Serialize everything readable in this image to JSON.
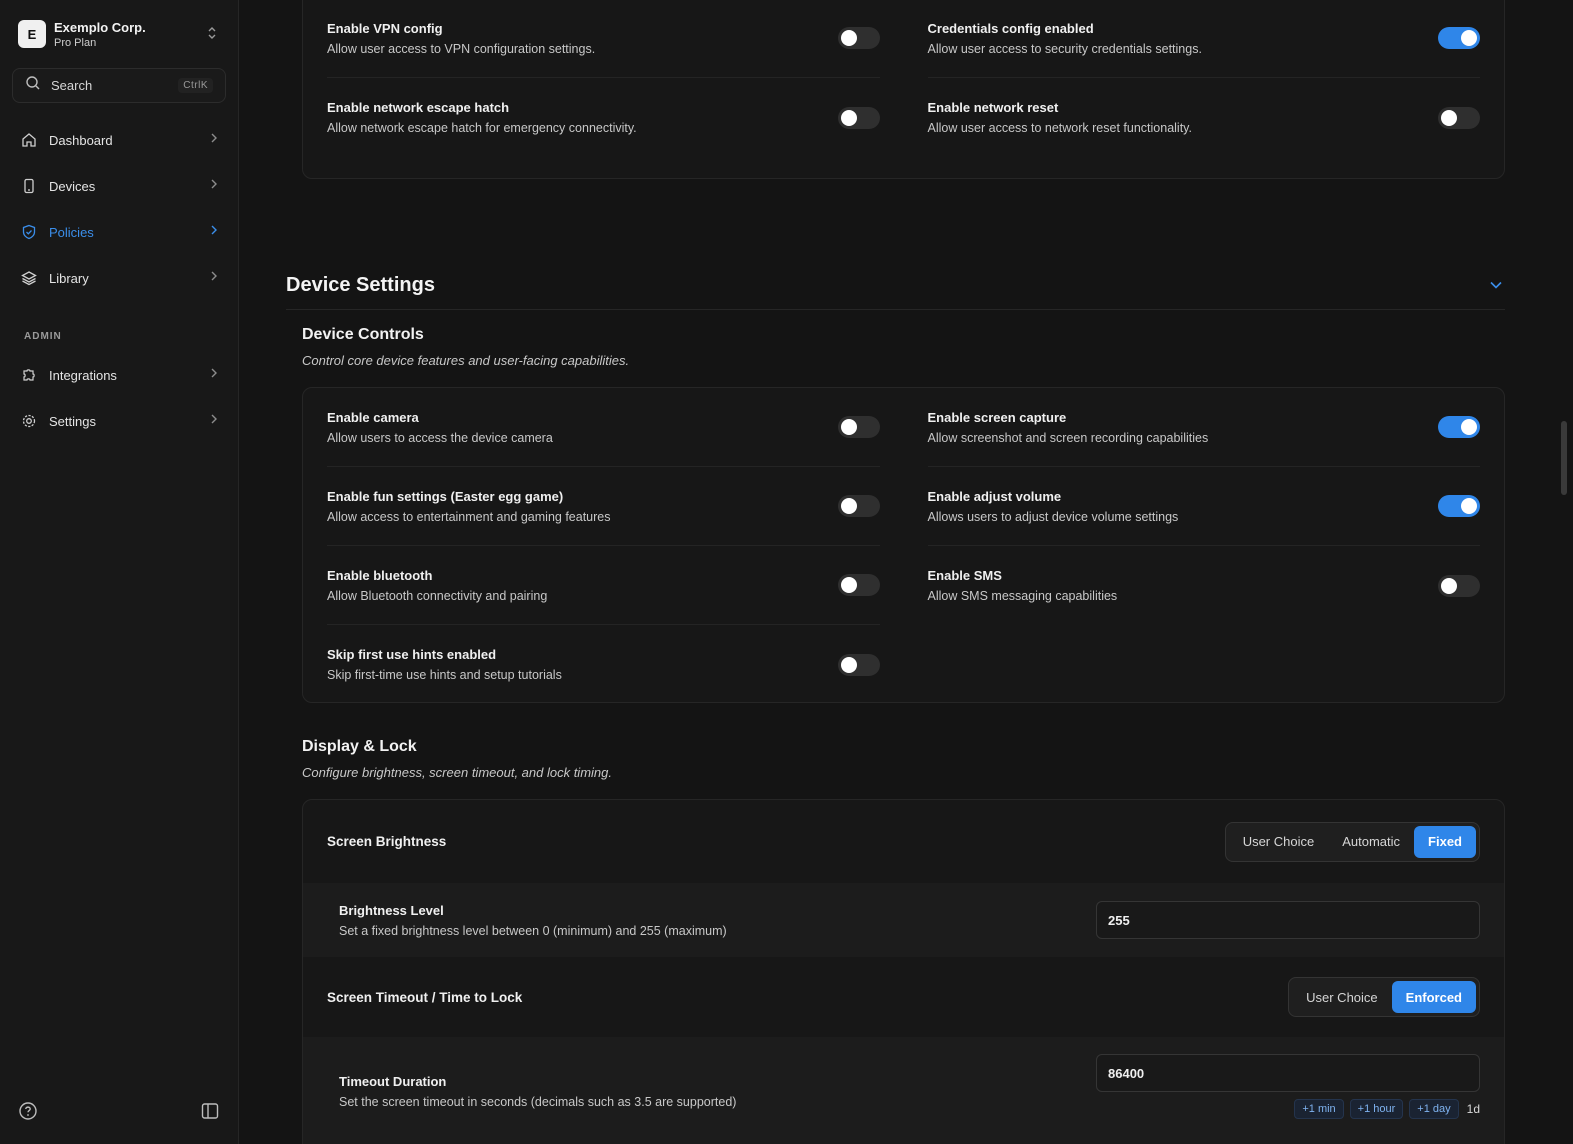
{
  "org": {
    "initial": "E",
    "name": "Exemplo Corp.",
    "plan": "Pro Plan"
  },
  "search": {
    "label": "Search",
    "shortcut": "CtrlK"
  },
  "nav": {
    "items": [
      {
        "label": "Dashboard"
      },
      {
        "label": "Devices"
      },
      {
        "label": "Policies"
      },
      {
        "label": "Library"
      }
    ],
    "admin_label": "ADMIN",
    "admin_items": [
      {
        "label": "Integrations"
      },
      {
        "label": "Settings"
      }
    ]
  },
  "network": {
    "rows": [
      {
        "title": "Enable VPN config",
        "desc": "Allow user access to VPN configuration settings.",
        "on": false
      },
      {
        "title": "Credentials config enabled",
        "desc": "Allow user access to security credentials settings.",
        "on": true
      },
      {
        "title": "Enable network escape hatch",
        "desc": "Allow network escape hatch for emergency connectivity.",
        "on": false
      },
      {
        "title": "Enable network reset",
        "desc": "Allow user access to network reset functionality.",
        "on": false
      }
    ]
  },
  "device_settings": {
    "title": "Device Settings",
    "controls": {
      "title": "Device Controls",
      "desc": "Control core device features and user-facing capabilities.",
      "rows": [
        {
          "title": "Enable camera",
          "desc": "Allow users to access the device camera",
          "on": false
        },
        {
          "title": "Enable screen capture",
          "desc": "Allow screenshot and screen recording capabilities",
          "on": true
        },
        {
          "title": "Enable fun settings (Easter egg game)",
          "desc": "Allow access to entertainment and gaming features",
          "on": false
        },
        {
          "title": "Enable adjust volume",
          "desc": "Allows users to adjust device volume settings",
          "on": true
        },
        {
          "title": "Enable bluetooth",
          "desc": "Allow Bluetooth connectivity and pairing",
          "on": false
        },
        {
          "title": "Enable SMS",
          "desc": "Allow SMS messaging capabilities",
          "on": false
        },
        {
          "title": "Skip first use hints enabled",
          "desc": "Skip first-time use hints and setup tutorials",
          "on": false
        }
      ]
    },
    "display": {
      "title": "Display & Lock",
      "desc": "Configure brightness, screen timeout, and lock timing.",
      "brightness": {
        "label": "Screen Brightness",
        "options": [
          "User Choice",
          "Automatic",
          "Fixed"
        ],
        "selected": "Fixed",
        "level_title": "Brightness Level",
        "level_desc": "Set a fixed brightness level between 0 (minimum) and 255 (maximum)",
        "level_value": "255"
      },
      "timeout": {
        "label": "Screen Timeout / Time to Lock",
        "options": [
          "User Choice",
          "Enforced"
        ],
        "selected": "Enforced",
        "duration_title": "Timeout Duration",
        "duration_desc": "Set the screen timeout in seconds (decimals such as 3.5 are supported)",
        "duration_value": "86400",
        "chips": [
          "+1 min",
          "+1 hour",
          "+1 day"
        ],
        "suffix": "1d"
      }
    }
  },
  "colors": {
    "accent": "#2f86e9",
    "bg": "#141414",
    "card": "#171717"
  }
}
